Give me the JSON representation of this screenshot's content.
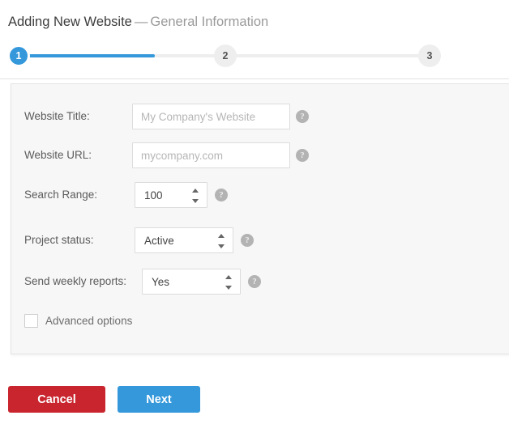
{
  "header": {
    "title": "Adding New Website",
    "separator": "—",
    "subtitle": "General Information"
  },
  "stepper": {
    "active_step": 1,
    "progress_percent": 30,
    "active_color": "#3498db",
    "inactive_color": "#eeeeee",
    "steps": [
      {
        "number": "1",
        "state": "active"
      },
      {
        "number": "2",
        "state": "inactive"
      },
      {
        "number": "3",
        "state": "inactive"
      }
    ]
  },
  "form": {
    "rows": [
      {
        "label": "Website Title:",
        "type": "text",
        "value": "",
        "placeholder": "My Company's Website",
        "help": "?"
      },
      {
        "label": "Website URL:",
        "type": "text",
        "value": "",
        "placeholder": "mycompany.com",
        "help": "?"
      },
      {
        "label": "Search Range:",
        "type": "number",
        "value": "100",
        "help": "?"
      },
      {
        "label": "Project status:",
        "type": "select",
        "value": "Active",
        "help": "?"
      },
      {
        "label": "Send weekly reports:",
        "type": "select",
        "value": "Yes",
        "help": "?"
      }
    ],
    "advanced_options": {
      "label": "Advanced options",
      "checked": false
    }
  },
  "footer": {
    "cancel_label": "Cancel",
    "cancel_color": "#c9252e",
    "next_label": "Next",
    "next_color": "#3498db"
  }
}
